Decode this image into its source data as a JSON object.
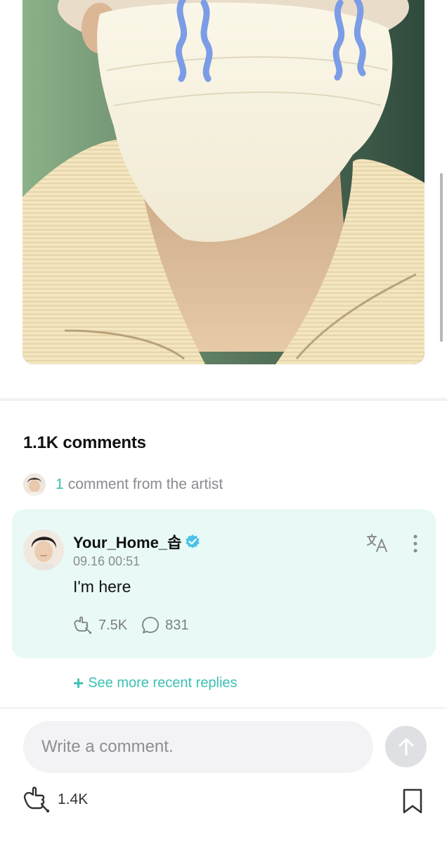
{
  "post": {
    "image_icon": "selfie-photo-masked"
  },
  "comments": {
    "title": "1.1K comments",
    "artist_summary": {
      "count": "1",
      "text": "comment from the artist"
    }
  },
  "artist_comment": {
    "author": "Your_Home_솝",
    "verified_icon": "verified-badge-icon",
    "timestamp": "09.16 00:51",
    "text": "I'm here",
    "like_count": "7.5K",
    "reply_count": "831",
    "translate_icon": "translate-icon",
    "more_icon": "more-vertical-icon"
  },
  "replies": {
    "see_more_plus": "+",
    "see_more": "See more recent replies"
  },
  "composer": {
    "placeholder": "Write a comment.",
    "send_icon": "arrow-up-icon"
  },
  "bottom_bar": {
    "like_count": "1.4K",
    "bookmark_icon": "bookmark-icon"
  },
  "colors": {
    "accent": "#3cc0b4",
    "card_background": "#e8f9f6",
    "verified": "#4cc2e8",
    "muted_text": "#8b8b90"
  }
}
